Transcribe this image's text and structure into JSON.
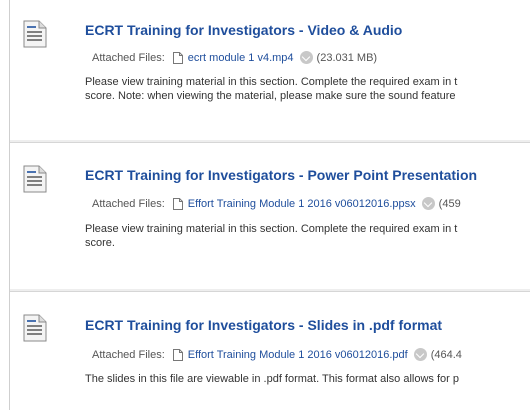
{
  "items": [
    {
      "title": "ECRT Training for Investigators - Video & Audio",
      "attached_label": "Attached Files:",
      "file_name": "ecrt module 1 v4.mp4",
      "file_size": "(23.031 MB)",
      "desc_lines": [
        "Please view training material in this section. Complete the required exam in t",
        "score. Note: when viewing the material, please make sure the sound feature"
      ]
    },
    {
      "title": "ECRT Training for Investigators - Power Point Presentation",
      "attached_label": "Attached Files:",
      "file_name": "Effort Training Module 1 2016 v06012016.ppsx",
      "file_size": "(459",
      "desc_lines": [
        "Please view training material in this section. Complete the required exam in t",
        "score."
      ]
    },
    {
      "title": "ECRT Training for Investigators - Slides in .pdf format",
      "attached_label": "Attached Files:",
      "file_name": "Effort Training Module 1 2016 v06012016.pdf",
      "file_size": "(464.4",
      "desc_lines": [
        "The slides in this file are viewable in .pdf format. This format also allows for p"
      ]
    }
  ],
  "colors": {
    "link": "#1f4e9c",
    "text": "#333333",
    "menu_button": "#c8c8c8"
  },
  "icons": {
    "item_icon": "document-icon",
    "file_icon": "file-icon",
    "menu": "chevron-down-icon"
  }
}
